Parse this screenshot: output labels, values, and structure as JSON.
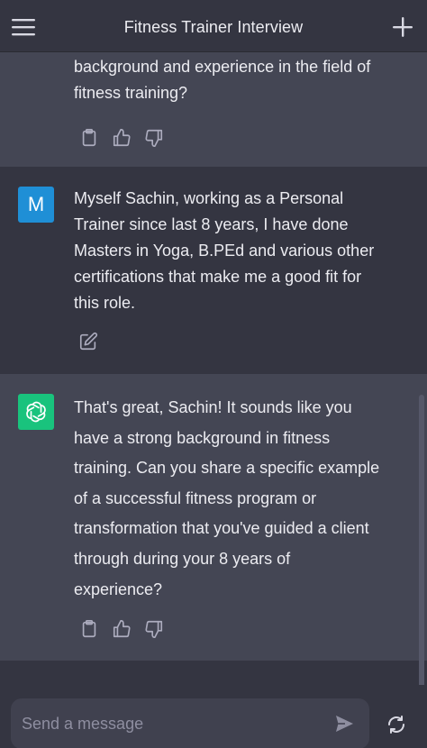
{
  "header": {
    "title": "Fitness Trainer Interview",
    "menu_icon": "hamburger-menu-icon",
    "new_chat_icon": "plus-icon"
  },
  "messages": [
    {
      "role": "assistant",
      "lines": [
        "background and experience in the field of",
        "fitness training?"
      ]
    },
    {
      "role": "user",
      "avatar_letter": "M",
      "lines": [
        "Myself Sachin, working as a Personal",
        "Trainer since last 8 years, I have done",
        "Masters in Yoga, B.PEd and various other",
        "certifications that make me a good fit for",
        "this role."
      ]
    },
    {
      "role": "assistant",
      "lines": [
        "That's great, Sachin! It sounds like you",
        "have a strong background in fitness",
        "training. Can you share a specific example",
        "of a successful fitness program or",
        "transformation that you've guided a client",
        "through during your 8 years of",
        "experience?"
      ]
    }
  ],
  "composer": {
    "placeholder": "Send a message"
  },
  "colors": {
    "background": "#343541",
    "assistant_row": "#444654",
    "user_avatar": "#1f8fd6",
    "bot_avatar": "#19c37d",
    "input": "#40414f"
  }
}
